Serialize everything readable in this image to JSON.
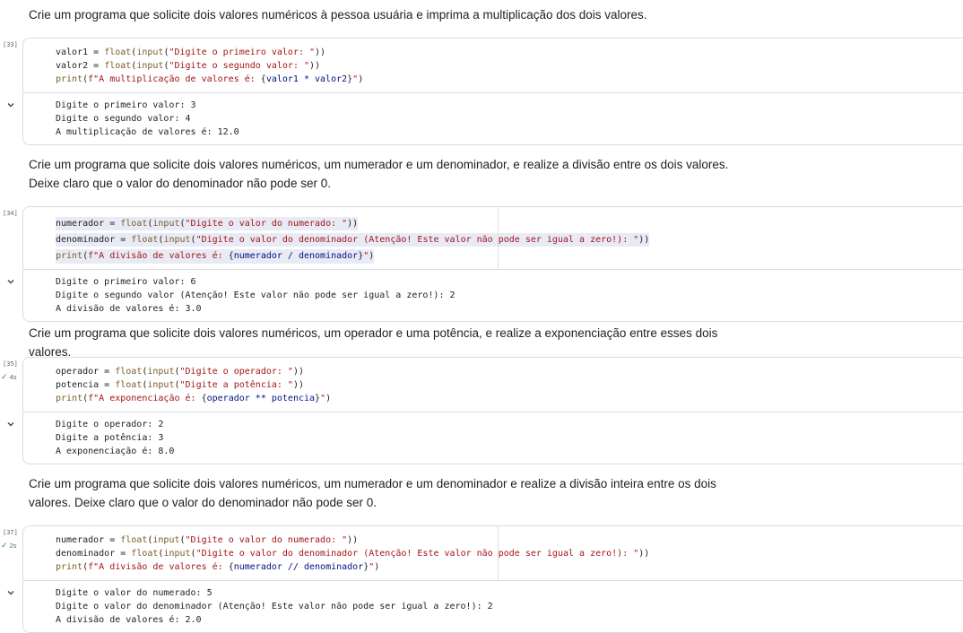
{
  "cells": [
    {
      "text": "Crie um programa que solicite dois valores numéricos à pessoa usuária e imprima a multiplicação dos dois valores."
    },
    {
      "exec_count": "[33]",
      "code": [
        "valor1 = float(input(\"Digite o primeiro valor: \"))",
        "valor2 = float(input(\"Digite o segundo valor: \"))",
        "print(f\"A multiplicação de valores é: {valor1 * valor2}\")"
      ],
      "output": [
        "Digite o primeiro valor: 3",
        "Digite o segundo valor: 4",
        "A multiplicação de valores é: 12.0"
      ]
    },
    {
      "text": "Crie um programa que solicite dois valores numéricos, um numerador e um denominador, e realize a divisão entre os dois valores. Deixe claro que o valor do denominador não pode ser 0."
    },
    {
      "exec_count": "[34]",
      "code": [
        "numerador = float(input(\"Digite o valor do numerado: \"))",
        "denominador = float(input(\"Digite o valor do denominador (Atenção! Este valor não pode ser igual a zero!): \"))",
        "print(f\"A divisão de valores é: {numerador / denominador}\")"
      ],
      "output": [
        "Digite o primeiro valor: 6",
        "Digite o segundo valor (Atenção! Este valor não pode ser igual a zero!): 2",
        "A divisão de valores é: 3.0"
      ]
    },
    {
      "text": "Crie um programa que solicite dois valores numéricos, um operador e uma potência, e realize a exponenciação entre esses dois valores."
    },
    {
      "exec_count": "[35]",
      "exec_time": "4s",
      "code": [
        "operador = float(input(\"Digite o operador: \"))",
        "potencia = float(input(\"Digite a potência: \"))",
        "print(f\"A exponenciação é: {operador ** potencia}\")"
      ],
      "output": [
        "Digite o operador: 2",
        "Digite a potência: 3",
        "A exponenciação é: 8.0"
      ]
    },
    {
      "text": "Crie um programa que solicite dois valores numéricos, um numerador e um denominador e realize a divisão inteira entre os dois valores. Deixe claro que o valor do denominador não pode ser 0."
    },
    {
      "exec_count": "[37]",
      "exec_time": "2s",
      "code": [
        "numerador = float(input(\"Digite o valor do numerado: \"))",
        "denominador = float(input(\"Digite o valor do denominador (Atenção! Este valor não pode ser igual a zero!): \"))",
        "print(f\"A divisão de valores é: {numerador // denominador}\")"
      ],
      "output": [
        "Digite o valor do numerado: 5",
        "Digite o valor do denominador (Atenção! Este valor não pode ser igual a zero!): 2",
        "A divisão de valores é: 2.0"
      ]
    }
  ],
  "icons": {
    "collapse": "chevron-down-icon",
    "success": "check-icon"
  },
  "colors": {
    "function": "#795e26",
    "keyword": "#0000ff",
    "string": "#a31515",
    "success": "#1e8e3e",
    "border": "#dadce0"
  }
}
